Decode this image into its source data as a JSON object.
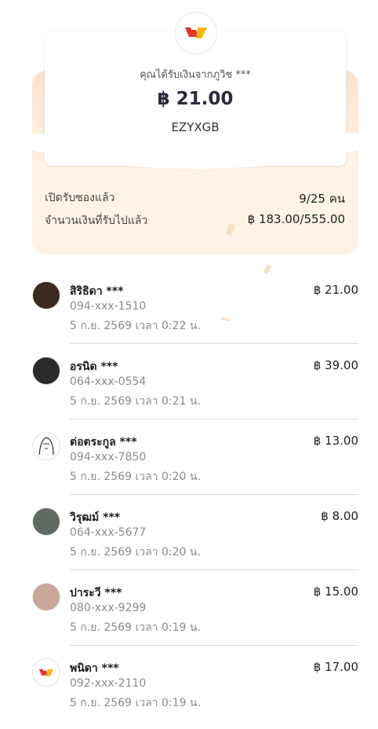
{
  "card": {
    "title": "คุณได้รับเงินจากภูวิช ***",
    "amount": "฿ 21.00",
    "code": "EZYXGB"
  },
  "stats": [
    {
      "label": "เปิดรับซองแล้ว",
      "value": "9/25 คน"
    },
    {
      "label": "จำนวนเงินที่รับไปแล้ว",
      "value": "฿ 183.00/555.00"
    }
  ],
  "recipients": [
    {
      "name": "สิริธิดา ***",
      "phone": "094-xxx-1510",
      "time": "5 ก.ย. 2569 เวลา 0:22 น.",
      "amount": "฿ 21.00",
      "avatar": "photo-avatar"
    },
    {
      "name": "อรนิด ***",
      "phone": "064-xxx-0554",
      "time": "5 ก.ย. 2569 เวลา 0:21 น.",
      "amount": "฿ 39.00",
      "avatar": "photo-avatar"
    },
    {
      "name": "ต่อตระกูล ***",
      "phone": "094-xxx-7850",
      "time": "5 ก.ย. 2569 เวลา 0:20 น.",
      "amount": "฿ 13.00",
      "avatar": "sketch-avatar"
    },
    {
      "name": "วิรุฒม์ ***",
      "phone": "064-xxx-5677",
      "time": "5 ก.ย. 2569 เวลา 0:20 น.",
      "amount": "฿ 8.00",
      "avatar": "photo-avatar"
    },
    {
      "name": "ปาระวี ***",
      "phone": "080-xxx-9299",
      "time": "5 ก.ย. 2569 เวลา 0:19 น.",
      "amount": "฿ 15.00",
      "avatar": "photo-avatar"
    },
    {
      "name": "พนิดา ***",
      "phone": "092-xxx-2110",
      "time": "5 ก.ย. 2569 เวลา 0:19 น.",
      "amount": "฿ 17.00",
      "avatar": "logo-avatar"
    }
  ],
  "colors": {
    "accent_red": "#e8322b",
    "accent_yellow": "#f7b813",
    "envelope": "#fde2cc"
  }
}
